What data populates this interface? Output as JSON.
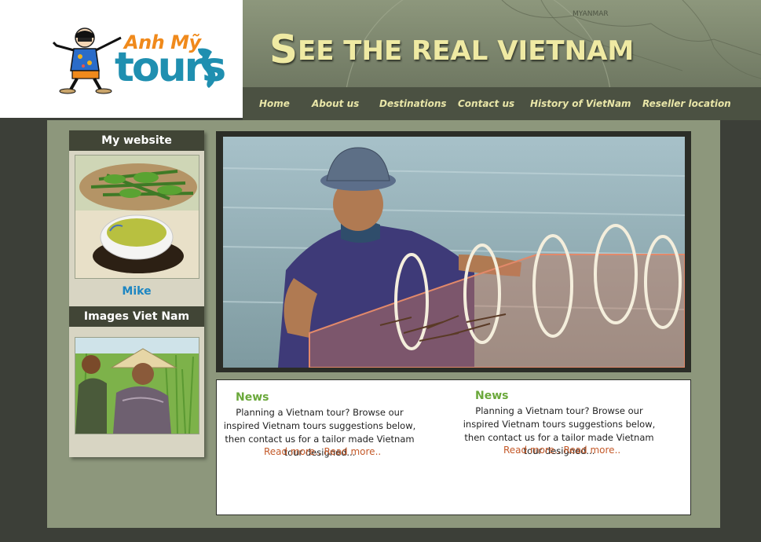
{
  "logo": {
    "brand_top": "Anh Mỹ",
    "brand_main": "tours"
  },
  "banner": {
    "title_first_letter": "S",
    "title_rest": "EE THE REAL VIETNAM",
    "map_label": "MYANMAR"
  },
  "nav": {
    "items": [
      {
        "label": "Home"
      },
      {
        "label": "About us"
      },
      {
        "label": "Destinations"
      },
      {
        "label": "Contact us"
      },
      {
        "label": "History of VietNam"
      },
      {
        "label": "Reseller location"
      }
    ]
  },
  "sidebar": {
    "section1_title": "My website",
    "section1_name": "Mike",
    "section2_title": "Images Viet Nam"
  },
  "news": [
    {
      "title": "News",
      "text": "Planning a Vietnam tour? Browse our inspired Vietnam tours suggestions below, then contact us for a tailor made Vietnam tour designed...",
      "more1": "Read more..",
      "more2": "Read more.."
    },
    {
      "title": "News",
      "text": "Planning a Vietnam tour? Browse our inspired Vietnam tours suggestions below, then contact us for a tailor made Vietnam tour designed...",
      "more1": "Read more..",
      "more2": "Read more.."
    }
  ],
  "colors": {
    "nav_text": "#e9e6a8",
    "banner_title": "#efeaa3",
    "news_title": "#6aa83a",
    "read_more": "#c45a2a",
    "link_blue": "#1d86c2"
  }
}
